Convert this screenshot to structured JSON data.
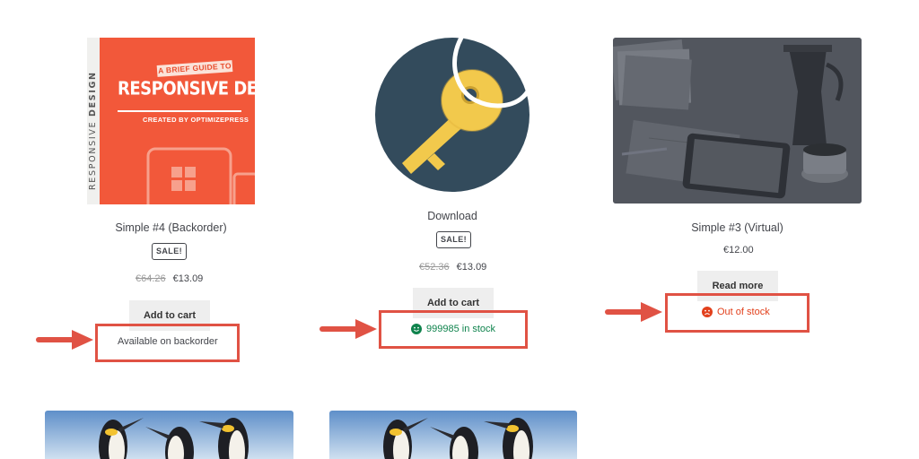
{
  "book_cover": {
    "spine_text_light": "RESPONSIVE ",
    "spine_text_bold": "DESIGN",
    "tag": "A BRIEF GUIDE TO",
    "headline": "RESPONSIVE DESIGN",
    "byline": "CREATED BY OPTIMIZEPRESS"
  },
  "products": [
    {
      "title": "Simple #4 (Backorder)",
      "badge": "SALE!",
      "old_price": "€64.26",
      "price": "€13.09",
      "button": "Add to cart",
      "stock": "Available on backorder",
      "stock_status": "backorder"
    },
    {
      "title": "Download",
      "badge": "SALE!",
      "old_price": "€52.36",
      "price": "€13.09",
      "button": "Add to cart",
      "stock": "999985 in stock",
      "stock_status": "in-stock"
    },
    {
      "title": "Simple #3 (Virtual)",
      "price": "€12.00",
      "button": "Read more",
      "stock": "Out of stock",
      "stock_status": "out-of-stock"
    }
  ],
  "colors": {
    "annotation": "#e05244",
    "in_stock": "#0f834d",
    "out_of_stock": "#e2401c",
    "button_bg": "#eeeeee",
    "text": "#43454b"
  },
  "icons": [
    "smile-icon",
    "frown-icon",
    "arrow-right-icon",
    "key-icon"
  ]
}
